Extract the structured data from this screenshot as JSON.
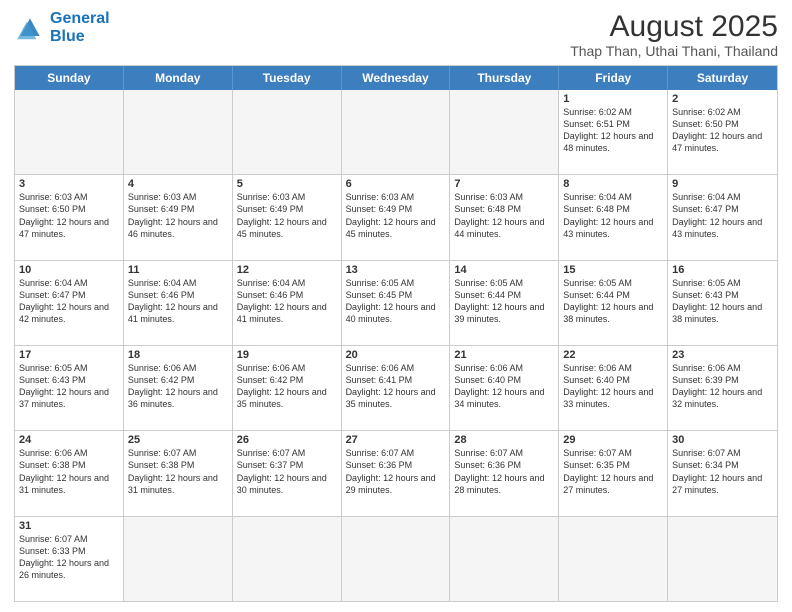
{
  "header": {
    "logo_line1": "General",
    "logo_line2": "Blue",
    "main_title": "August 2025",
    "subtitle": "Thap Than, Uthai Thani, Thailand"
  },
  "days_of_week": [
    "Sunday",
    "Monday",
    "Tuesday",
    "Wednesday",
    "Thursday",
    "Friday",
    "Saturday"
  ],
  "rows": [
    [
      {
        "day": "",
        "info": "",
        "empty": true
      },
      {
        "day": "",
        "info": "",
        "empty": true
      },
      {
        "day": "",
        "info": "",
        "empty": true
      },
      {
        "day": "",
        "info": "",
        "empty": true
      },
      {
        "day": "",
        "info": "",
        "empty": true
      },
      {
        "day": "1",
        "info": "Sunrise: 6:02 AM\nSunset: 6:51 PM\nDaylight: 12 hours and 48 minutes.",
        "empty": false
      },
      {
        "day": "2",
        "info": "Sunrise: 6:02 AM\nSunset: 6:50 PM\nDaylight: 12 hours and 47 minutes.",
        "empty": false
      }
    ],
    [
      {
        "day": "3",
        "info": "Sunrise: 6:03 AM\nSunset: 6:50 PM\nDaylight: 12 hours and 47 minutes.",
        "empty": false
      },
      {
        "day": "4",
        "info": "Sunrise: 6:03 AM\nSunset: 6:49 PM\nDaylight: 12 hours and 46 minutes.",
        "empty": false
      },
      {
        "day": "5",
        "info": "Sunrise: 6:03 AM\nSunset: 6:49 PM\nDaylight: 12 hours and 45 minutes.",
        "empty": false
      },
      {
        "day": "6",
        "info": "Sunrise: 6:03 AM\nSunset: 6:49 PM\nDaylight: 12 hours and 45 minutes.",
        "empty": false
      },
      {
        "day": "7",
        "info": "Sunrise: 6:03 AM\nSunset: 6:48 PM\nDaylight: 12 hours and 44 minutes.",
        "empty": false
      },
      {
        "day": "8",
        "info": "Sunrise: 6:04 AM\nSunset: 6:48 PM\nDaylight: 12 hours and 43 minutes.",
        "empty": false
      },
      {
        "day": "9",
        "info": "Sunrise: 6:04 AM\nSunset: 6:47 PM\nDaylight: 12 hours and 43 minutes.",
        "empty": false
      }
    ],
    [
      {
        "day": "10",
        "info": "Sunrise: 6:04 AM\nSunset: 6:47 PM\nDaylight: 12 hours and 42 minutes.",
        "empty": false
      },
      {
        "day": "11",
        "info": "Sunrise: 6:04 AM\nSunset: 6:46 PM\nDaylight: 12 hours and 41 minutes.",
        "empty": false
      },
      {
        "day": "12",
        "info": "Sunrise: 6:04 AM\nSunset: 6:46 PM\nDaylight: 12 hours and 41 minutes.",
        "empty": false
      },
      {
        "day": "13",
        "info": "Sunrise: 6:05 AM\nSunset: 6:45 PM\nDaylight: 12 hours and 40 minutes.",
        "empty": false
      },
      {
        "day": "14",
        "info": "Sunrise: 6:05 AM\nSunset: 6:44 PM\nDaylight: 12 hours and 39 minutes.",
        "empty": false
      },
      {
        "day": "15",
        "info": "Sunrise: 6:05 AM\nSunset: 6:44 PM\nDaylight: 12 hours and 38 minutes.",
        "empty": false
      },
      {
        "day": "16",
        "info": "Sunrise: 6:05 AM\nSunset: 6:43 PM\nDaylight: 12 hours and 38 minutes.",
        "empty": false
      }
    ],
    [
      {
        "day": "17",
        "info": "Sunrise: 6:05 AM\nSunset: 6:43 PM\nDaylight: 12 hours and 37 minutes.",
        "empty": false
      },
      {
        "day": "18",
        "info": "Sunrise: 6:06 AM\nSunset: 6:42 PM\nDaylight: 12 hours and 36 minutes.",
        "empty": false
      },
      {
        "day": "19",
        "info": "Sunrise: 6:06 AM\nSunset: 6:42 PM\nDaylight: 12 hours and 35 minutes.",
        "empty": false
      },
      {
        "day": "20",
        "info": "Sunrise: 6:06 AM\nSunset: 6:41 PM\nDaylight: 12 hours and 35 minutes.",
        "empty": false
      },
      {
        "day": "21",
        "info": "Sunrise: 6:06 AM\nSunset: 6:40 PM\nDaylight: 12 hours and 34 minutes.",
        "empty": false
      },
      {
        "day": "22",
        "info": "Sunrise: 6:06 AM\nSunset: 6:40 PM\nDaylight: 12 hours and 33 minutes.",
        "empty": false
      },
      {
        "day": "23",
        "info": "Sunrise: 6:06 AM\nSunset: 6:39 PM\nDaylight: 12 hours and 32 minutes.",
        "empty": false
      }
    ],
    [
      {
        "day": "24",
        "info": "Sunrise: 6:06 AM\nSunset: 6:38 PM\nDaylight: 12 hours and 31 minutes.",
        "empty": false
      },
      {
        "day": "25",
        "info": "Sunrise: 6:07 AM\nSunset: 6:38 PM\nDaylight: 12 hours and 31 minutes.",
        "empty": false
      },
      {
        "day": "26",
        "info": "Sunrise: 6:07 AM\nSunset: 6:37 PM\nDaylight: 12 hours and 30 minutes.",
        "empty": false
      },
      {
        "day": "27",
        "info": "Sunrise: 6:07 AM\nSunset: 6:36 PM\nDaylight: 12 hours and 29 minutes.",
        "empty": false
      },
      {
        "day": "28",
        "info": "Sunrise: 6:07 AM\nSunset: 6:36 PM\nDaylight: 12 hours and 28 minutes.",
        "empty": false
      },
      {
        "day": "29",
        "info": "Sunrise: 6:07 AM\nSunset: 6:35 PM\nDaylight: 12 hours and 27 minutes.",
        "empty": false
      },
      {
        "day": "30",
        "info": "Sunrise: 6:07 AM\nSunset: 6:34 PM\nDaylight: 12 hours and 27 minutes.",
        "empty": false
      }
    ],
    [
      {
        "day": "31",
        "info": "Sunrise: 6:07 AM\nSunset: 6:33 PM\nDaylight: 12 hours and 26 minutes.",
        "empty": false
      },
      {
        "day": "",
        "info": "",
        "empty": true
      },
      {
        "day": "",
        "info": "",
        "empty": true
      },
      {
        "day": "",
        "info": "",
        "empty": true
      },
      {
        "day": "",
        "info": "",
        "empty": true
      },
      {
        "day": "",
        "info": "",
        "empty": true
      },
      {
        "day": "",
        "info": "",
        "empty": true
      }
    ]
  ]
}
